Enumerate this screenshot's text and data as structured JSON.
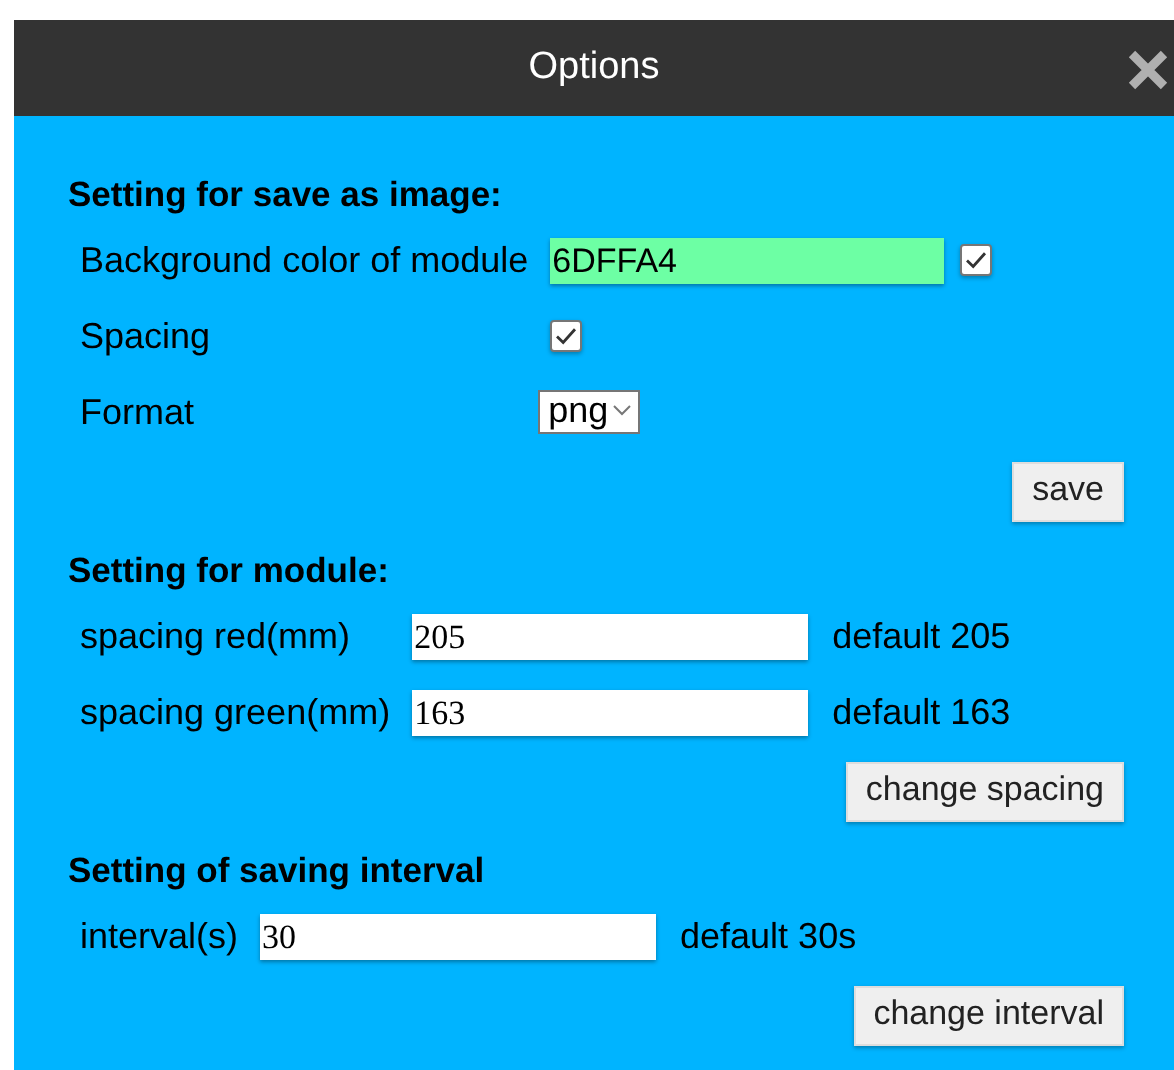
{
  "dialog": {
    "title": "Options"
  },
  "sections": [
    {
      "heading": "Setting for save as image:",
      "rows": [
        {
          "kind": "text_checkbox",
          "label": "Background color of module",
          "value": "6DFFA4",
          "checked": true
        },
        {
          "kind": "checkbox",
          "label": "Spacing",
          "checked": true
        },
        {
          "kind": "select",
          "label": "Format",
          "value": "png"
        }
      ],
      "button": "save"
    },
    {
      "heading": "Setting for module:",
      "rows": [
        {
          "kind": "text",
          "label": "spacing red(mm)",
          "value": "205",
          "note": "default 205"
        },
        {
          "kind": "text",
          "label": "spacing green(mm)",
          "value": "163",
          "note": "default 163"
        }
      ],
      "button": "change spacing"
    },
    {
      "heading": "Setting of saving interval",
      "rows": [
        {
          "kind": "text",
          "label": "interval(s)",
          "value": "30",
          "note": "default 30s"
        }
      ],
      "button": "change interval"
    }
  ]
}
